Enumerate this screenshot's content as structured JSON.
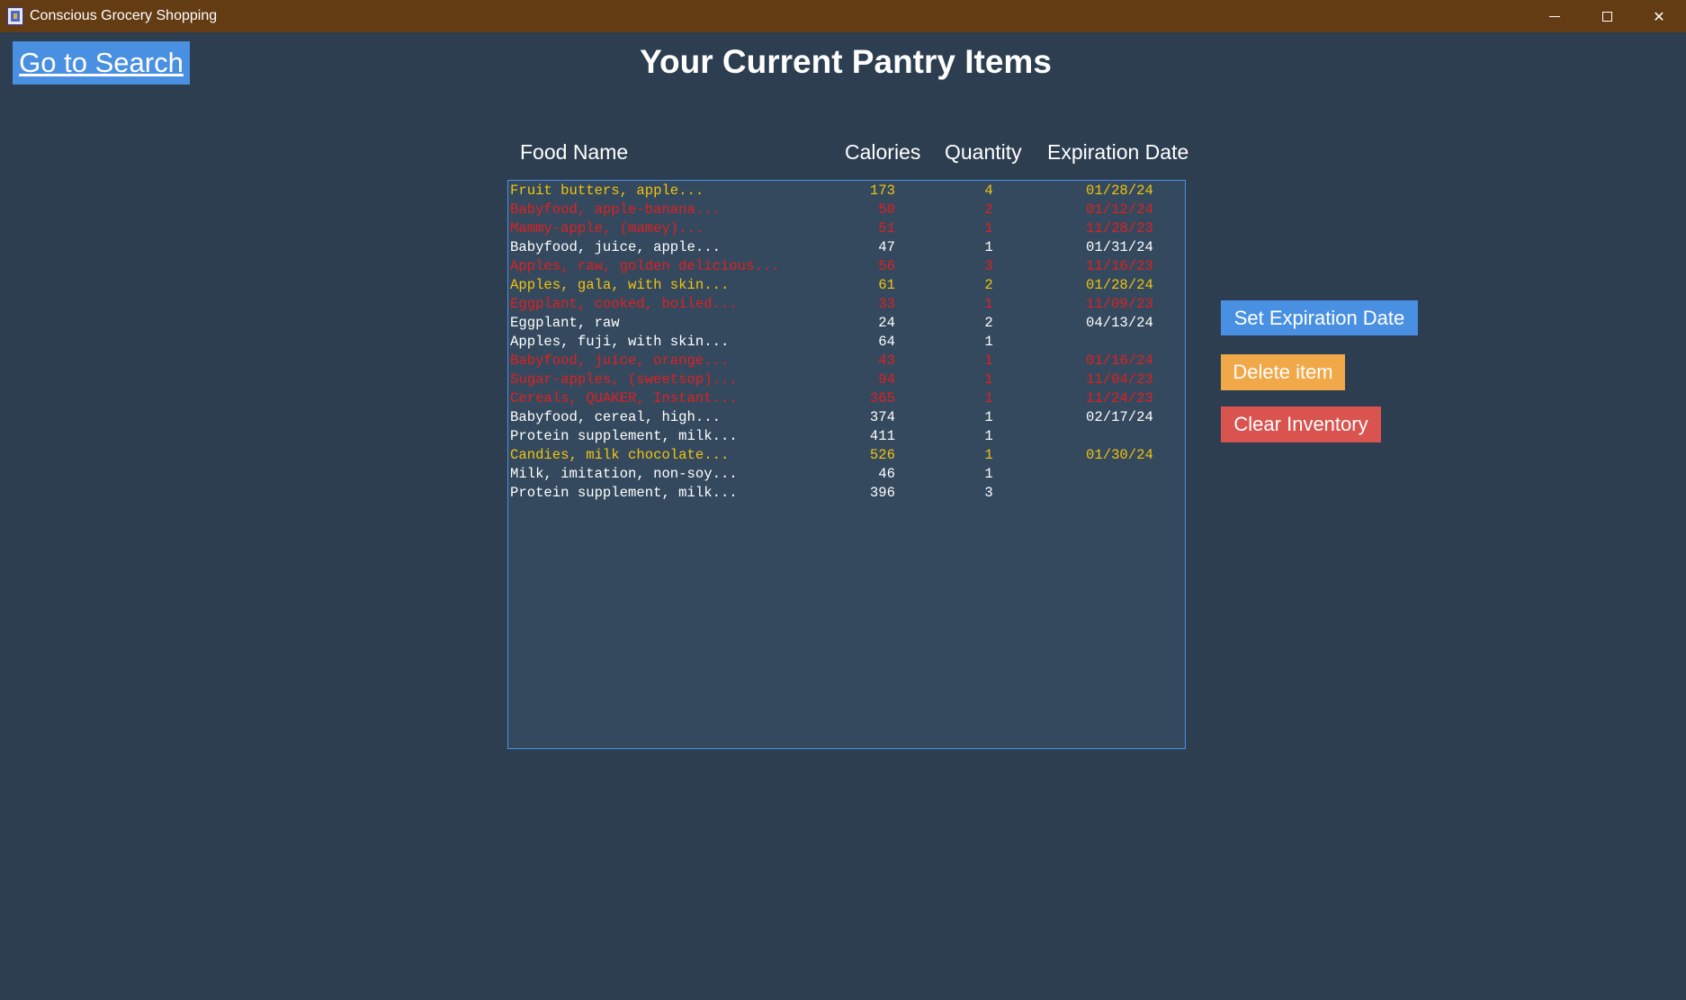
{
  "window": {
    "title": "Conscious Grocery Shopping",
    "controls": [
      "minimize",
      "maximize",
      "close"
    ]
  },
  "nav": {
    "go_to_search": "Go to Search"
  },
  "page_title": "Your Current Pantry Items",
  "columns": {
    "food_name": "Food Name",
    "calories": "Calories",
    "quantity": "Quantity",
    "expiration": "Expiration Date"
  },
  "colors": {
    "background": "#2c3e50",
    "titlebar": "#643c14",
    "listbox": "#34495e",
    "listbox_border": "#4a90e2",
    "fresh": "#ffffff",
    "expiring_soon": "#f1c40f",
    "expired": "#e02020",
    "set_expiration_button": "#4a90e2",
    "delete_button": "#f0a848",
    "clear_button": "#d9534f"
  },
  "items": [
    {
      "name": "Fruit butters, apple...",
      "calories": "173",
      "quantity": "4",
      "expiration": "01/28/24",
      "status": "expiring_soon"
    },
    {
      "name": "Babyfood, apple-banana...",
      "calories": "50",
      "quantity": "2",
      "expiration": "01/12/24",
      "status": "expired"
    },
    {
      "name": "Mammy-apple, (mamey)...",
      "calories": "51",
      "quantity": "1",
      "expiration": "11/28/23",
      "status": "expired"
    },
    {
      "name": "Babyfood, juice, apple...",
      "calories": "47",
      "quantity": "1",
      "expiration": "01/31/24",
      "status": "fresh"
    },
    {
      "name": "Apples, raw, golden delicious...",
      "calories": "56",
      "quantity": "3",
      "expiration": "11/16/23",
      "status": "expired"
    },
    {
      "name": "Apples, gala, with skin...",
      "calories": "61",
      "quantity": "2",
      "expiration": "01/28/24",
      "status": "expiring_soon"
    },
    {
      "name": "Eggplant, cooked, boiled...",
      "calories": "33",
      "quantity": "1",
      "expiration": "11/09/23",
      "status": "expired"
    },
    {
      "name": "Eggplant, raw",
      "calories": "24",
      "quantity": "2",
      "expiration": "04/13/24",
      "status": "fresh"
    },
    {
      "name": "Apples, fuji, with skin...",
      "calories": "64",
      "quantity": "1",
      "expiration": "",
      "status": "fresh"
    },
    {
      "name": "Babyfood, juice, orange...",
      "calories": "43",
      "quantity": "1",
      "expiration": "01/16/24",
      "status": "expired"
    },
    {
      "name": "Sugar-apples, (sweetsop)...",
      "calories": "94",
      "quantity": "1",
      "expiration": "11/04/23",
      "status": "expired"
    },
    {
      "name": "Cereals, QUAKER, Instant...",
      "calories": "365",
      "quantity": "1",
      "expiration": "11/24/23",
      "status": "expired"
    },
    {
      "name": "Babyfood, cereal, high...",
      "calories": "374",
      "quantity": "1",
      "expiration": "02/17/24",
      "status": "fresh"
    },
    {
      "name": "Protein supplement, milk...",
      "calories": "411",
      "quantity": "1",
      "expiration": "",
      "status": "fresh"
    },
    {
      "name": "Candies, milk chocolate...",
      "calories": "526",
      "quantity": "1",
      "expiration": "01/30/24",
      "status": "expiring_soon"
    },
    {
      "name": "Milk, imitation, non-soy...",
      "calories": "46",
      "quantity": "1",
      "expiration": "",
      "status": "fresh"
    },
    {
      "name": "Protein supplement, milk...",
      "calories": "396",
      "quantity": "3",
      "expiration": "",
      "status": "fresh"
    }
  ],
  "actions": {
    "set_expiration": "Set Expiration Date",
    "delete_item": "Delete item",
    "clear_inventory": "Clear Inventory"
  }
}
